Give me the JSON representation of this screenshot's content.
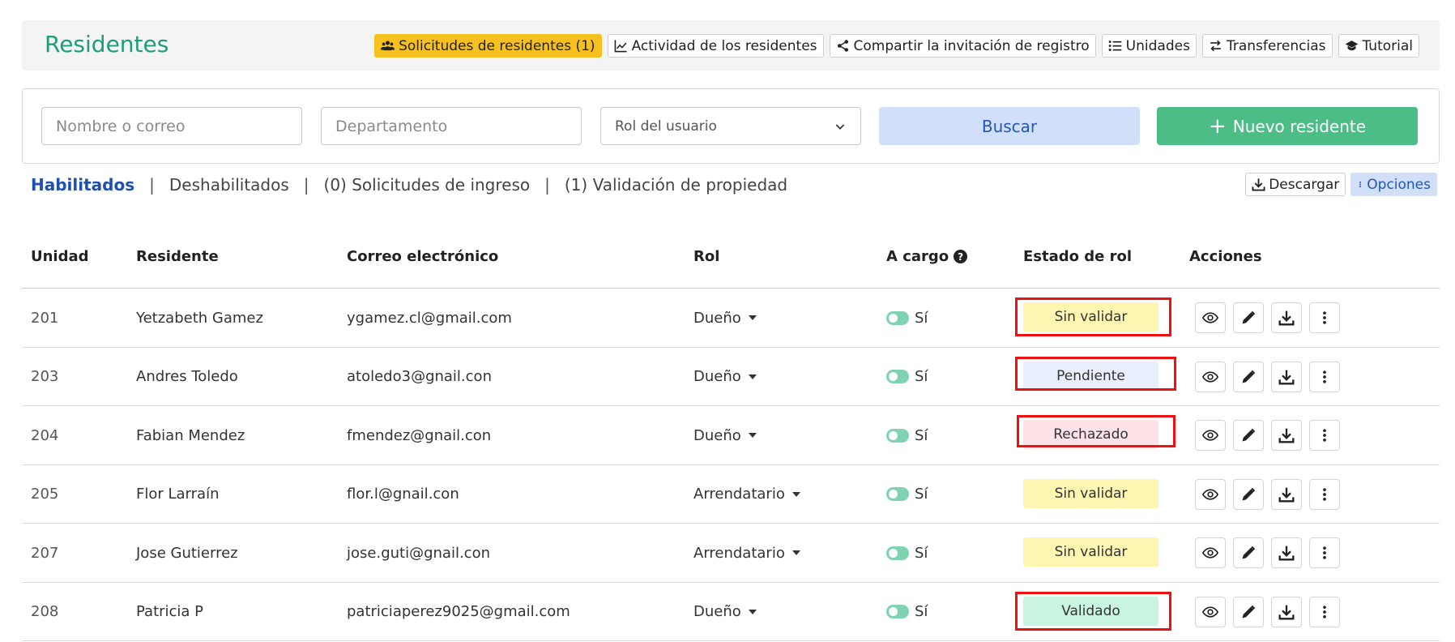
{
  "header": {
    "title": "Residentes",
    "tools": [
      {
        "label": "Solicitudes de residentes (1)",
        "icon": "users-icon",
        "active": true
      },
      {
        "label": "Actividad de los residentes",
        "icon": "chart-line-icon"
      },
      {
        "label": "Compartir la invitación de registro",
        "icon": "share-icon"
      },
      {
        "label": "Unidades",
        "icon": "list-icon"
      },
      {
        "label": "Transferencias",
        "icon": "transfer-icon"
      },
      {
        "label": "Tutorial",
        "icon": "graduation-cap-icon"
      }
    ]
  },
  "filters": {
    "name_placeholder": "Nombre o correo",
    "department_placeholder": "Departamento",
    "role_select": "Rol del usuario",
    "search_label": "Buscar",
    "new_label": "Nuevo residente",
    "new_prefix": "+"
  },
  "tabs": {
    "enabled": "Habilitados",
    "disabled": "Deshabilitados",
    "requests": "(0) Solicitudes de ingreso",
    "validation": "(1) Validación de propiedad",
    "separator": "|"
  },
  "toolbar": {
    "download": "Descargar",
    "options": "Opciones"
  },
  "table": {
    "headers": {
      "unit": "Unidad",
      "resident": "Residente",
      "email": "Correo electrónico",
      "role": "Rol",
      "in_charge": "A cargo",
      "role_status": "Estado de rol",
      "actions": "Acciones",
      "help": "?"
    },
    "rows": [
      {
        "unit": "201",
        "resident": "Yetzabeth Gamez",
        "email": "ygamez.cl@gmail.com",
        "role": "Dueño",
        "in_charge": "Sí",
        "status": "Sin validar",
        "status_color": "#fcf6b2",
        "highlighted": true
      },
      {
        "unit": "203",
        "resident": "Andres Toledo",
        "email": "atoledo3@gnail.con",
        "role": "Dueño",
        "in_charge": "Sí",
        "status": "Pendiente",
        "status_color": "#e8eefc",
        "highlighted": true
      },
      {
        "unit": "204",
        "resident": "Fabian Mendez",
        "email": "fmendez@gnail.con",
        "role": "Dueño",
        "in_charge": "Sí",
        "status": "Rechazado",
        "status_color": "#fde2e7",
        "highlighted": true
      },
      {
        "unit": "205",
        "resident": "Flor Larraín",
        "email": "flor.l@gnail.con",
        "role": "Arrendatario",
        "in_charge": "Sí",
        "status": "Sin validar",
        "status_color": "#fcf6b2",
        "highlighted": false
      },
      {
        "unit": "207",
        "resident": "Jose Gutierrez",
        "email": "jose.guti@gnail.con",
        "role": "Arrendatario",
        "in_charge": "Sí",
        "status": "Sin validar",
        "status_color": "#fcf6b2",
        "highlighted": false
      },
      {
        "unit": "208",
        "resident": "Patricia P",
        "email": "patriciaperez9025@gmail.com",
        "role": "Dueño",
        "in_charge": "Sí",
        "status": "Validado",
        "status_color": "#c9f4e0",
        "highlighted": true
      }
    ],
    "row_actions": [
      "eye-icon",
      "pencil-icon",
      "download-icon",
      "more-vertical-icon"
    ]
  },
  "colors": {
    "accent": "#1e9e78",
    "highlight": "#ef1010",
    "primary_blue": "#2456b4",
    "green": "#4cbd86",
    "yellow": "#f6c11e"
  }
}
